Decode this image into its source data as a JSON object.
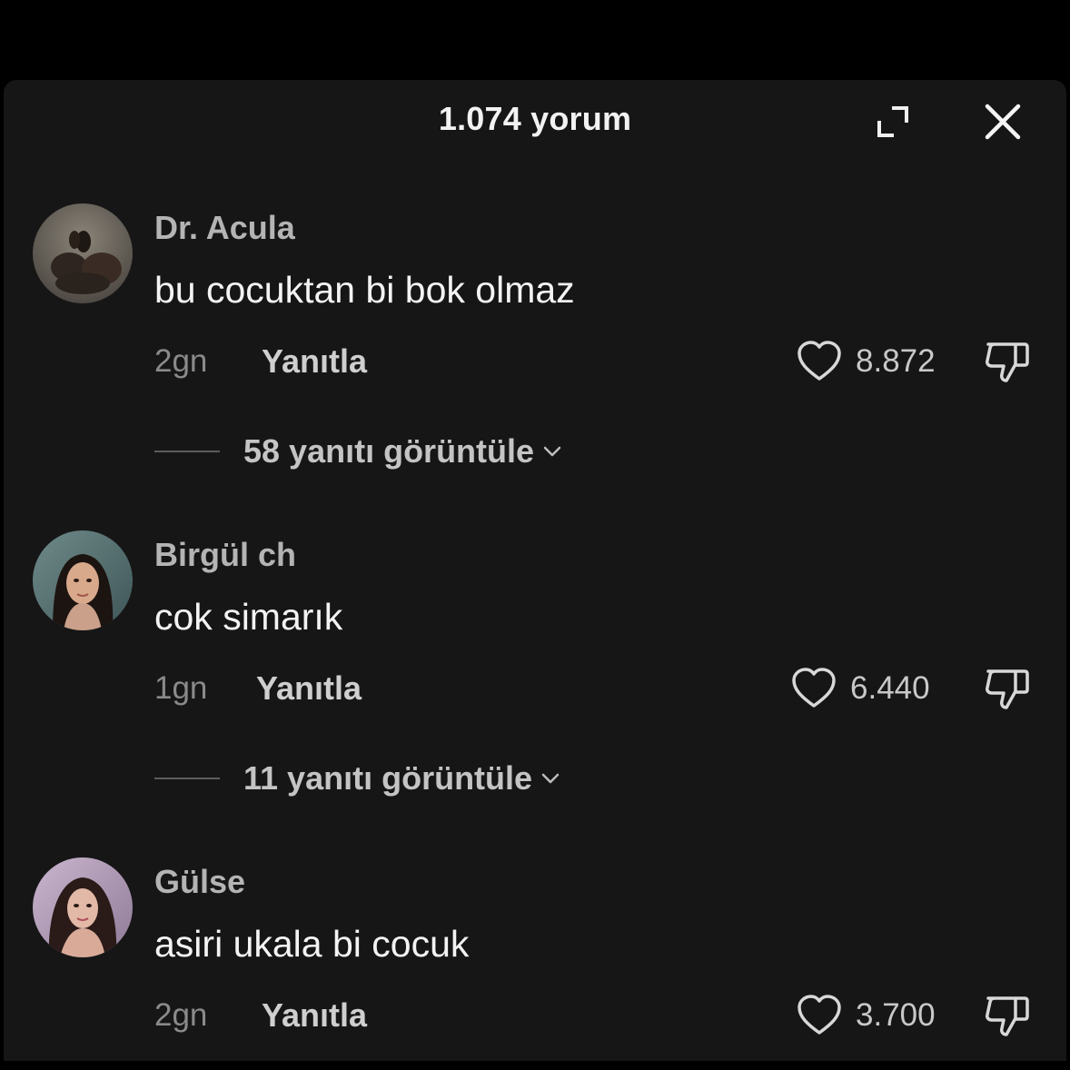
{
  "header": {
    "title": "1.074 yorum"
  },
  "comments": [
    {
      "username": "Dr. Acula",
      "text": "bu cocuktan bi bok olmaz",
      "time": "2gn",
      "reply_label": "Yanıtla",
      "likes": "8.872",
      "view_replies": "58 yanıtı görüntüle"
    },
    {
      "username": "Birgül ch",
      "text": "cok simarık",
      "time": "1gn",
      "reply_label": "Yanıtla",
      "likes": "6.440",
      "view_replies": "11 yanıtı görüntüle"
    },
    {
      "username": "Gülse",
      "text": "asiri ukala bi cocuk",
      "time": "2gn",
      "reply_label": "Yanıtla",
      "likes": "3.700"
    }
  ],
  "colors": {
    "background": "#000000",
    "sheet": "#161616",
    "primary_text": "#f3f3f3",
    "secondary_text": "#b4b4b4"
  },
  "icons": {
    "expand": "expand-icon",
    "close": "close-icon",
    "like": "heart-icon",
    "dislike": "thumbs-down-icon",
    "chevron": "chevron-down-icon"
  }
}
